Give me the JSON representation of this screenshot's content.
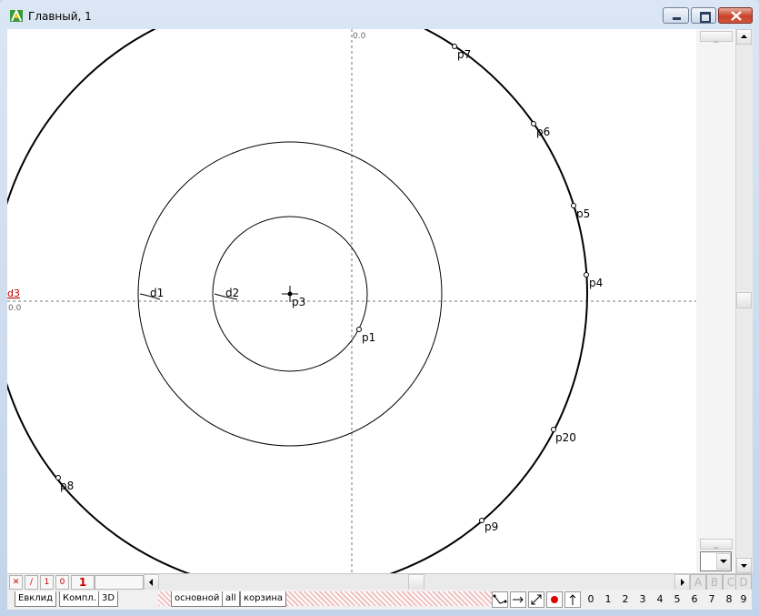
{
  "window": {
    "title": "Главный, 1"
  },
  "canvas": {
    "axis_origin_top": "0.0",
    "axis_origin_left": "0.0",
    "axis_label_left": "d3",
    "labels": {
      "d1": "d1",
      "d2": "d2",
      "p1": "p1",
      "p3": "p3",
      "p4": "p4",
      "p5": "p5",
      "p6": "p6",
      "p7": "p7",
      "p8": "p8",
      "p9": "p9",
      "p20": "p20"
    }
  },
  "bottombar": {
    "counter": "1",
    "btn_1": "1",
    "btn_0": "0"
  },
  "tabs_left": [
    "Евклид",
    "Компл.",
    "3D"
  ],
  "tabs_layers": [
    "основной",
    "all",
    "корзина"
  ],
  "abcd": [
    "A",
    "B",
    "C",
    "D"
  ],
  "digits": [
    "0",
    "1",
    "2",
    "3",
    "4",
    "5",
    "6",
    "7",
    "8",
    "9"
  ]
}
